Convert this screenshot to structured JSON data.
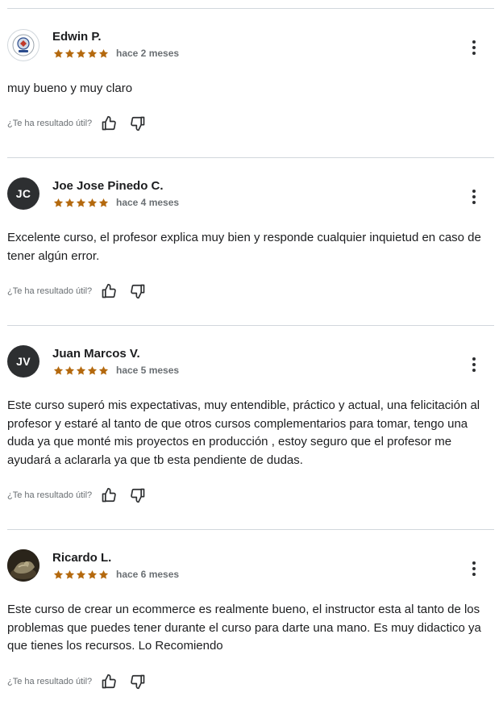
{
  "colors": {
    "star": "#b4690e",
    "text": "#1c1d1f",
    "muted": "#6a6f73",
    "divider": "#d1d7dc",
    "avatar_bg": "#2d2f31"
  },
  "helpful_prompt": "¿Te ha resultado útil?",
  "reviews": [
    {
      "reviewer": "Edwin P.",
      "avatar": {
        "type": "logo-image"
      },
      "rating": 5,
      "time": "hace 2 meses",
      "text": "muy bueno y muy claro"
    },
    {
      "reviewer": "Joe Jose Pinedo C.",
      "avatar": {
        "type": "initials",
        "initials": "JC"
      },
      "rating": 5,
      "time": "hace 4 meses",
      "text": "Excelente curso, el profesor explica muy bien y responde cualquier inquietud en caso de tener algún error."
    },
    {
      "reviewer": "Juan Marcos V.",
      "avatar": {
        "type": "initials",
        "initials": "JV"
      },
      "rating": 5,
      "time": "hace 5 meses",
      "text": "Este curso superó mis expectativas, muy entendible, práctico y actual, una felicitación al profesor y estaré al tanto de que otros cursos complementarios para tomar, tengo una duda ya que monté mis proyectos en producción , estoy seguro que el profesor me ayudará a aclararla ya que tb esta pendiente de dudas."
    },
    {
      "reviewer": "Ricardo L.",
      "avatar": {
        "type": "photo"
      },
      "rating": 5,
      "time": "hace 6 meses",
      "text": "Este curso de crear un ecommerce es realmente bueno, el instructor esta al tanto de los problemas que puedes tener durante el curso para darte una mano. Es muy didactico ya que tienes los recursos. Lo Recomiendo"
    }
  ]
}
